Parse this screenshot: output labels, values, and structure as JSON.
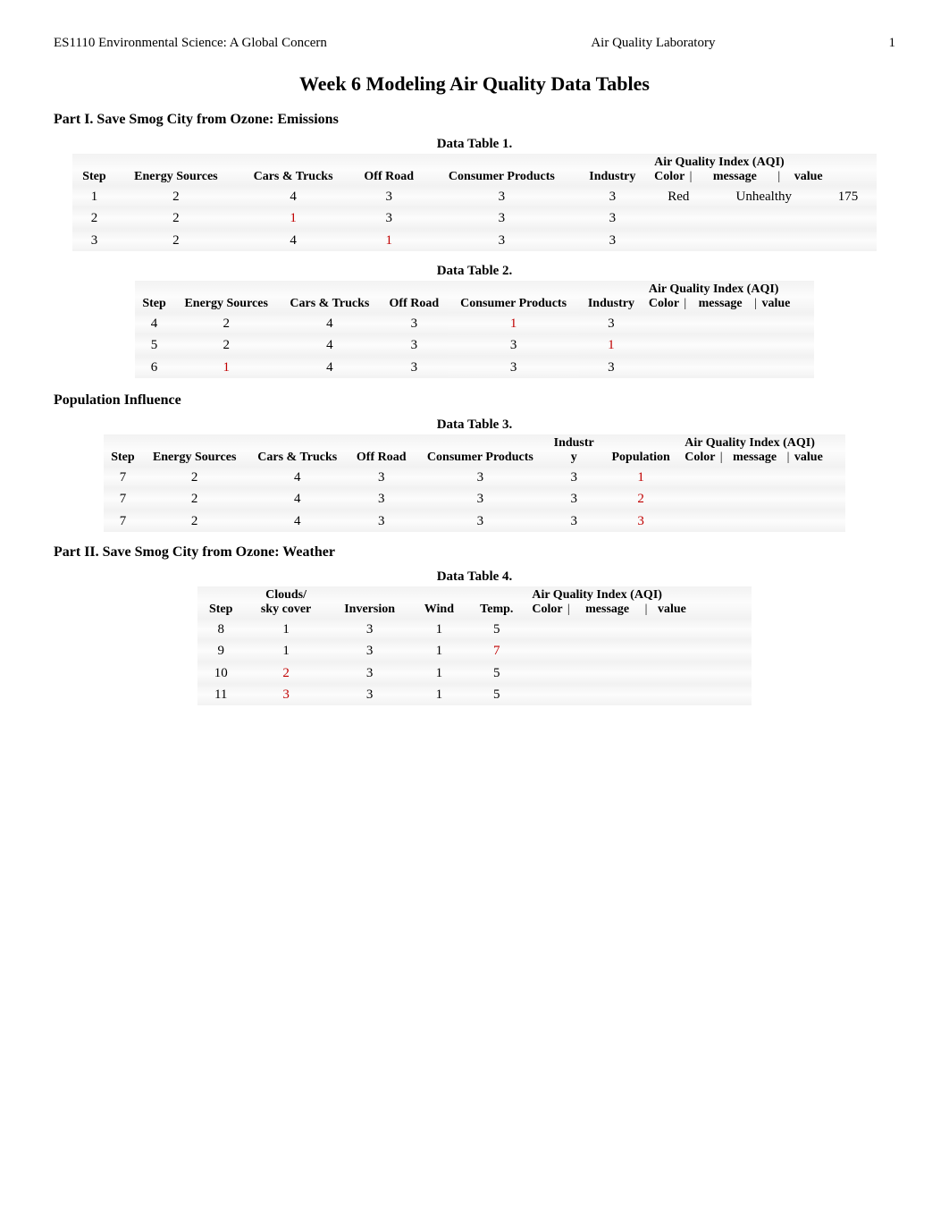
{
  "header": {
    "left": "ES1110 Environmental Science: A Global Concern",
    "center": "Air Quality Laboratory",
    "right": "1"
  },
  "page_title": "Week 6 Modeling Air Quality Data Tables",
  "part1_title": "Part I. Save Smog City from Ozone: Emissions",
  "population_title": "Population Influence",
  "part2_title": "Part II. Save Smog City from Ozone: Weather",
  "headers": {
    "step": "Step",
    "energy_sources": "Energy Sources",
    "cars_trucks": "Cars & Trucks",
    "off_road": "Off Road",
    "consumer_products": "Consumer Products",
    "industry": "Industry",
    "industr_y_top": "Industr",
    "industr_y_bot": "y",
    "population": "Population",
    "clouds_sky_top": "Clouds/",
    "clouds_sky_bot": "sky cover",
    "inversion": "Inversion",
    "wind": "Wind",
    "temp": "Temp.",
    "aqi": "Air Quality Index (AQI)",
    "color": "Color",
    "message": "message",
    "value": "value",
    "pipe": "|"
  },
  "table1": {
    "caption": "Data Table 1.",
    "rows": [
      {
        "step": "1",
        "energy": "2",
        "cars": "4",
        "off": "3",
        "consumer": "3",
        "industry": "3",
        "color": "Red",
        "message": "Unhealthy",
        "value": "175"
      },
      {
        "step": "2",
        "energy": "2",
        "cars": "1",
        "off": "3",
        "consumer": "3",
        "industry": "3",
        "color": "",
        "message": "",
        "value": ""
      },
      {
        "step": "3",
        "energy": "2",
        "cars": "4",
        "off": "1",
        "consumer": "3",
        "industry": "3",
        "color": "",
        "message": "",
        "value": ""
      }
    ]
  },
  "table2": {
    "caption": "Data Table 2.",
    "rows": [
      {
        "step": "4",
        "energy": "2",
        "cars": "4",
        "off": "3",
        "consumer": "1",
        "industry": "3",
        "color": "",
        "message": "",
        "value": ""
      },
      {
        "step": "5",
        "energy": "2",
        "cars": "4",
        "off": "3",
        "consumer": "3",
        "industry": "1",
        "color": "",
        "message": "",
        "value": ""
      },
      {
        "step": "6",
        "energy": "1",
        "cars": "4",
        "off": "3",
        "consumer": "3",
        "industry": "3",
        "color": "",
        "message": "",
        "value": ""
      }
    ]
  },
  "table3": {
    "caption": "Data Table 3.",
    "rows": [
      {
        "step": "7",
        "energy": "2",
        "cars": "4",
        "off": "3",
        "consumer": "3",
        "industry": "3",
        "pop": "1",
        "color": "",
        "message": "",
        "value": ""
      },
      {
        "step": "7",
        "energy": "2",
        "cars": "4",
        "off": "3",
        "consumer": "3",
        "industry": "3",
        "pop": "2",
        "color": "",
        "message": "",
        "value": ""
      },
      {
        "step": "7",
        "energy": "2",
        "cars": "4",
        "off": "3",
        "consumer": "3",
        "industry": "3",
        "pop": "3",
        "color": "",
        "message": "",
        "value": ""
      }
    ]
  },
  "table4": {
    "caption": "Data Table 4.",
    "rows": [
      {
        "step": "8",
        "clouds": "1",
        "inversion": "3",
        "wind": "1",
        "temp": "5",
        "color": "",
        "message": "",
        "value": ""
      },
      {
        "step": "9",
        "clouds": "1",
        "inversion": "3",
        "wind": "1",
        "temp": "7",
        "color": "",
        "message": "",
        "value": ""
      },
      {
        "step": "10",
        "clouds": "2",
        "inversion": "3",
        "wind": "1",
        "temp": "5",
        "color": "",
        "message": "",
        "value": ""
      },
      {
        "step": "11",
        "clouds": "3",
        "inversion": "3",
        "wind": "1",
        "temp": "5",
        "color": "",
        "message": "",
        "value": ""
      }
    ]
  },
  "highlights": {
    "t1": [
      [
        1,
        "cars"
      ],
      [
        2,
        "off"
      ]
    ],
    "t2": [
      [
        0,
        "consumer"
      ],
      [
        1,
        "industry"
      ],
      [
        2,
        "energy"
      ]
    ],
    "t3_pop": [
      [
        0
      ],
      [
        1
      ],
      [
        2
      ]
    ],
    "t4": [
      [
        1,
        "temp",
        "red"
      ],
      [
        2,
        "clouds",
        "red"
      ],
      [
        3,
        "clouds",
        "red"
      ]
    ]
  }
}
